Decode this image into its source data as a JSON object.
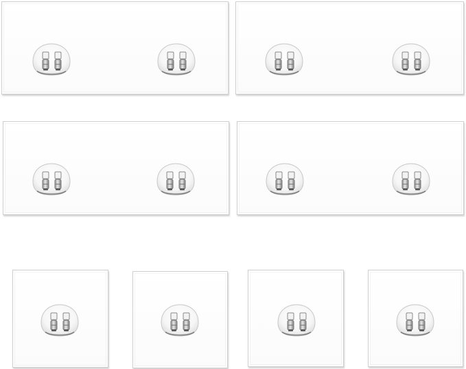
{
  "image": {
    "subject": "adhesive-wall-hook-pads",
    "background_color": "#ffffff"
  },
  "pads": [
    {
      "id": "wide-1",
      "shape": "rectangle",
      "mounts": 2
    },
    {
      "id": "wide-2",
      "shape": "rectangle",
      "mounts": 2
    },
    {
      "id": "wide-3",
      "shape": "rectangle",
      "mounts": 2
    },
    {
      "id": "wide-4",
      "shape": "rectangle",
      "mounts": 2
    },
    {
      "id": "square-1",
      "shape": "square",
      "mounts": 1
    },
    {
      "id": "square-2",
      "shape": "square",
      "mounts": 1
    },
    {
      "id": "square-3",
      "shape": "square",
      "mounts": 1
    },
    {
      "id": "square-4",
      "shape": "square",
      "mounts": 1
    }
  ],
  "counts": {
    "wide_pads": 4,
    "square_pads": 4,
    "total_pads": 8
  },
  "colors": {
    "pad_fill": "#fbfbfb",
    "pad_border": "#cfcfcf",
    "mount_metal": "#9a9a9a"
  }
}
